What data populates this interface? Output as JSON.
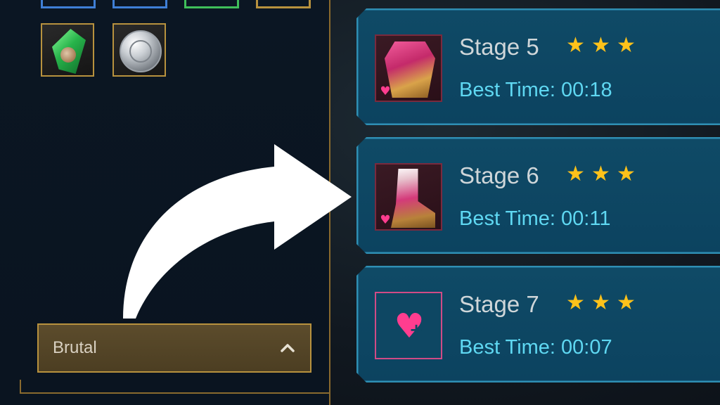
{
  "difficulty": {
    "selected": "Brutal",
    "chevron_icon": "chevron-up-icon"
  },
  "rewards": [
    {
      "icon": "green-gem-icon"
    },
    {
      "icon": "silver-coin-icon"
    }
  ],
  "stages": [
    {
      "title": "Stage 5",
      "stars": 3,
      "best_time": "Best Time: 00:18",
      "icon": "chest-armor-icon"
    },
    {
      "title": "Stage 6",
      "stars": 3,
      "best_time": "Best Time: 00:11",
      "icon": "boots-armor-icon"
    },
    {
      "title": "Stage 7",
      "stars": 3,
      "best_time": "Best Time: 00:07",
      "icon": "heart-plus-icon"
    }
  ],
  "colors": {
    "card_bg": "#0f4a66",
    "card_border": "#2f8fb3",
    "best_time_text": "#5fd8f2",
    "star": "#ffc21a",
    "heart": "#ff3d8f",
    "gold_border": "#b8923e"
  }
}
